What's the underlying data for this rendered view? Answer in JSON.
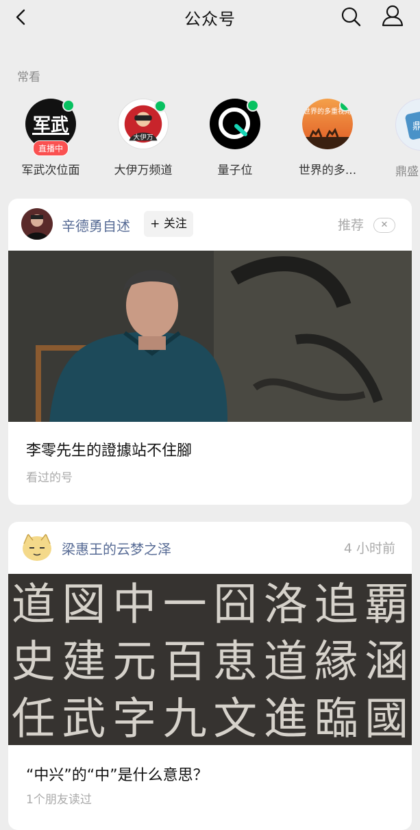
{
  "header": {
    "title": "公众号"
  },
  "section_label": "常看",
  "frequent": [
    {
      "name": "军武次位面",
      "logo_text": "军武",
      "badge": "直播中"
    },
    {
      "name": "大伊万频道",
      "logo_text": "大伊万"
    },
    {
      "name": "量子位"
    },
    {
      "name": "世界的多...",
      "logo_text": "世界的多重视角"
    },
    {
      "name": "鼎盛",
      "logo_text": "鼎盛"
    }
  ],
  "cards": [
    {
      "account": "辛德勇自述",
      "follow_label": "+ 关注",
      "right_label": "推荐",
      "close_symbol": "✕",
      "title": "李零先生的證據站不住腳",
      "sub": "看过的号"
    },
    {
      "account": "梁惠王的云梦之泽",
      "right_label": "4 小时前",
      "title": "“中兴”的“中”是什么意思？",
      "sub": "1个朋友读过",
      "calligraphy_glyphs": [
        "道",
        "史",
        "任",
        "図",
        "建",
        "武",
        "中",
        "元",
        "字",
        "一",
        "百",
        "九",
        "囧",
        "恵",
        "文",
        "洛",
        "道",
        "進",
        "追",
        "縁",
        "臨",
        "覇",
        "涵",
        "國"
      ]
    }
  ]
}
